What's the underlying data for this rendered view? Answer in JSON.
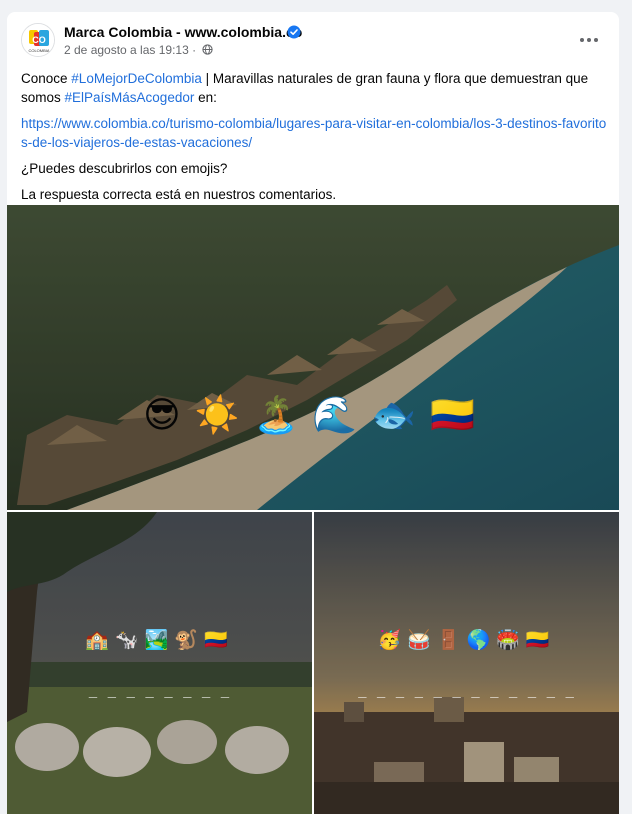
{
  "post": {
    "page_name": "Marca Colombia - www.colombia.co",
    "timestamp": "2 de agosto a las 19:13",
    "separator": " · ",
    "verified": true,
    "privacy_icon": "globe-icon",
    "more_icon": "more-options-icon",
    "avatar_text": "CO",
    "avatar_subtext": "COLOMBIA"
  },
  "content": {
    "line1_prefix": "Conoce ",
    "hashtag1": "#LoMejorDeColombia",
    "line1_suffix": " | Maravillas naturales de gran fauna y flora que demuestran que somos ",
    "hashtag2": "#ElPaísMásAcogedor",
    "line1_end": " en:",
    "link": "https://www.colombia.co/turismo-colombia/lugares-para-visitar-en-colombia/los-3-destinos-favoritos-de-los-viajeros-de-estas-vacaciones/",
    "question": "¿Puedes descubrirlos con emojis?",
    "answer_note": "La respuesta correcta está en nuestros comentarios."
  },
  "photos": {
    "main": {
      "emojis": "😎☀️🏝️🌊🐟🇨🇴"
    },
    "left": {
      "emojis": "🏫🐄🏞️🐒🇨🇴",
      "blanks": "_ _ _ _ _ _ _ _"
    },
    "right": {
      "emojis": "🥳🥁🚪🌎🏟️🇨🇴",
      "blanks": "_ _ _ _ _ _ _ _ _ _ _ _"
    }
  },
  "colors": {
    "link": "#216fdb",
    "verified_badge": "#1877f2",
    "secondary_text": "#65676b"
  }
}
